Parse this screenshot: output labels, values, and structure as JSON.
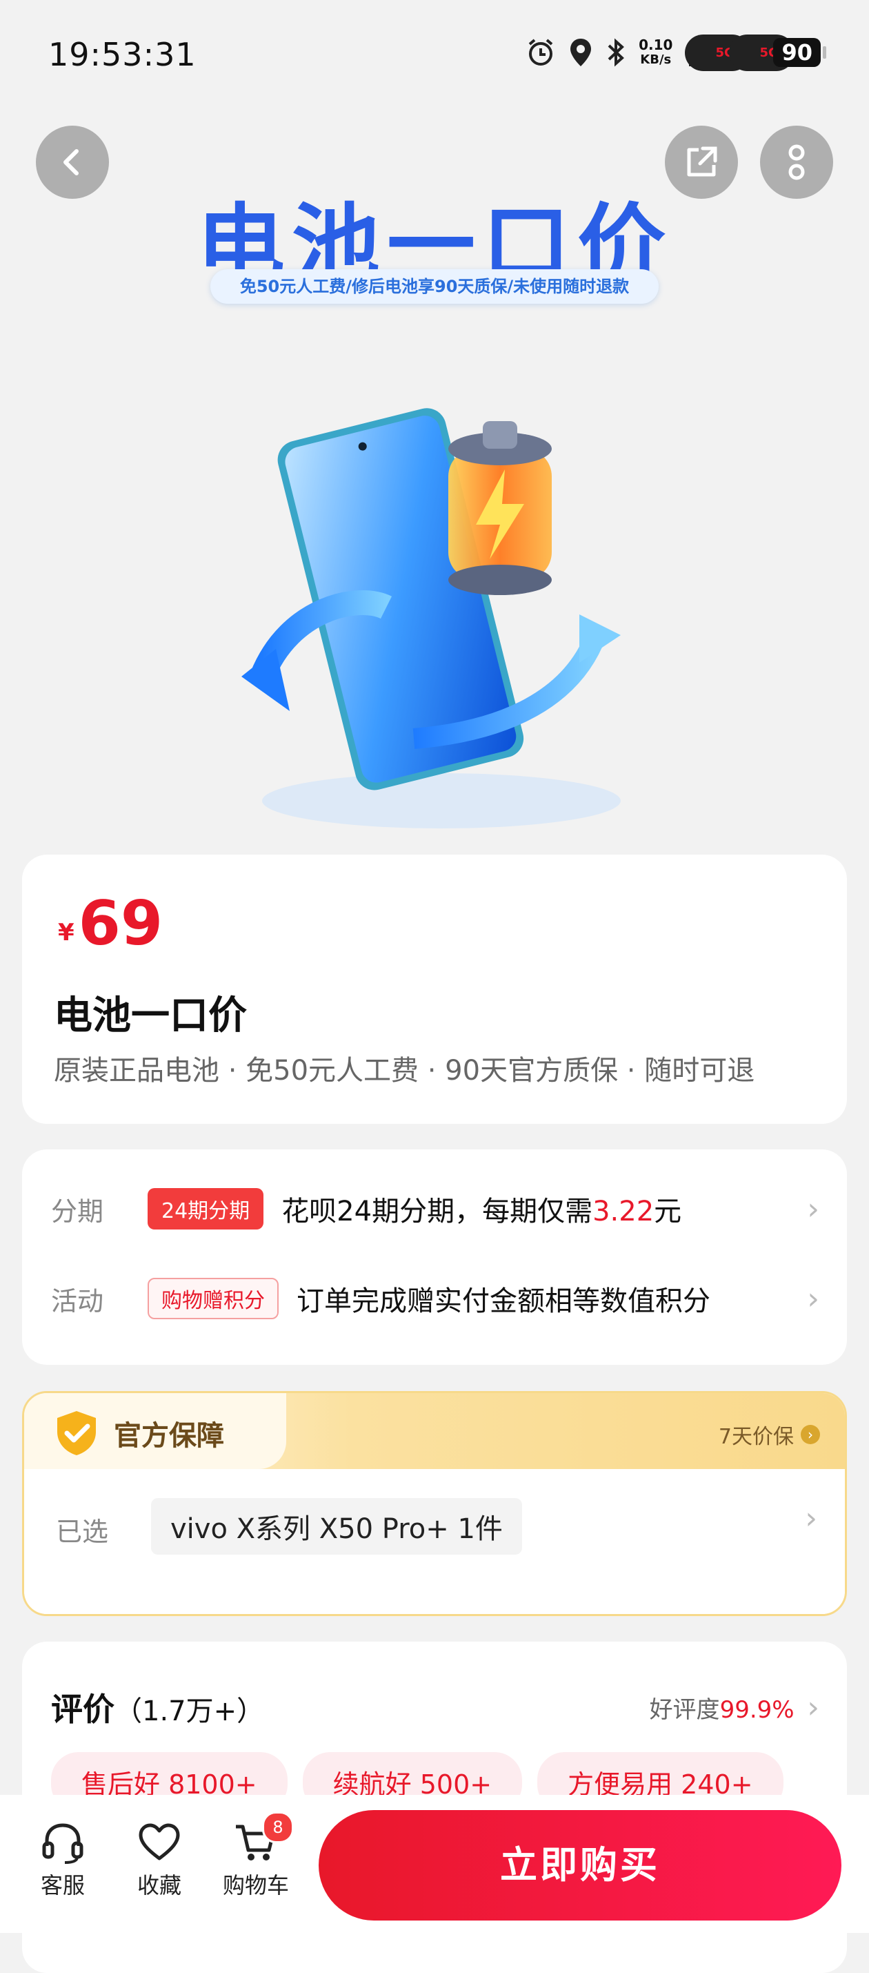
{
  "status_bar": {
    "time": "19:53:31",
    "net_speed_value": "0.10",
    "net_speed_unit": "KB/s",
    "sim1": "5G",
    "sim2": "5G",
    "battery": "90"
  },
  "header": {
    "back_icon": "chevron-left-icon",
    "share_icon": "share-icon",
    "more_icon": "more-icon"
  },
  "hero": {
    "title": "电池一口价",
    "subtitle": "免50元人工费/修后电池享90天质保/未使用随时退款"
  },
  "product": {
    "currency": "¥",
    "price": "69",
    "title": "电池一口价",
    "description": "原装正品电池 · 免50元人工费 · 90天官方质保 · 随时可退"
  },
  "activities": {
    "installment": {
      "label": "分期",
      "badge": "24期分期",
      "text_prefix": "花呗24期分期，每期仅需",
      "amount": "3.22",
      "text_suffix": "元"
    },
    "promotion": {
      "label": "活动",
      "badge": "购物赠积分",
      "text": "订单完成赠实付金额相等数值积分"
    }
  },
  "guarantee": {
    "title": "官方保障",
    "right_text": "7天价保",
    "selected_label": "已选",
    "selected_value": "vivo X系列 X50 Pro+ 1件"
  },
  "reviews": {
    "title": "评价",
    "count": "（1.7万+）",
    "rate_label": "好评度",
    "rate_value": "99.9%",
    "tags": [
      "售后好 8100+",
      "续航好 500+",
      "方便易用 240+"
    ]
  },
  "bottom_bar": {
    "service_label": "客服",
    "favorite_label": "收藏",
    "cart_label": "购物车",
    "cart_count": "8",
    "buy_label": "立即购买"
  },
  "colors": {
    "accent_red": "#e8182a",
    "hero_blue": "#2a5fe6",
    "guarantee_gold": "#f7d98a"
  }
}
